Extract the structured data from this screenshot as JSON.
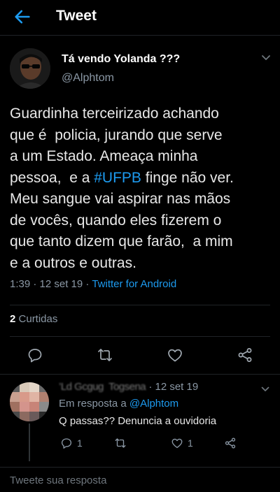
{
  "header": {
    "title": "Tweet"
  },
  "tweet": {
    "display_name": "Tá vendo Yolanda ???",
    "handle": "@Alphtom",
    "text_before_hashtag": "Guardinha terceirizado achando\nque é  policia, jurando que serve\na um Estado. Ameaça minha\npessoa,  e a ",
    "hashtag": "#UFPB",
    "text_after_hashtag": " finge não ver.\nMeu sangue vai aspirar nas mãos\nde vocês, quando eles fizerem o\nque tanto dizem que farão,  a mim\ne a outros e outras.",
    "timestamp": "1:39 · 12 set 19 · ",
    "source": "Twitter for Android",
    "likes_count": "2",
    "likes_label": "Curtidas"
  },
  "reply": {
    "obscured_name": "’Ld Gcgug  Togsena",
    "date": " · 12 set 19",
    "in_reply_prefix": "Em resposta a ",
    "in_reply_mention": "@Alphtom",
    "text": "Q passas?? Denuncia a ouvidoria",
    "reply_count": "1",
    "like_count": "1"
  },
  "composer": {
    "placeholder": "Tweete sua resposta"
  },
  "colors": {
    "accent": "#1d9bf0",
    "background": "#000000",
    "muted": "#8b98a5"
  },
  "icons": [
    "back-arrow-icon",
    "chevron-down-icon",
    "reply-icon",
    "retweet-icon",
    "like-icon",
    "share-icon"
  ]
}
